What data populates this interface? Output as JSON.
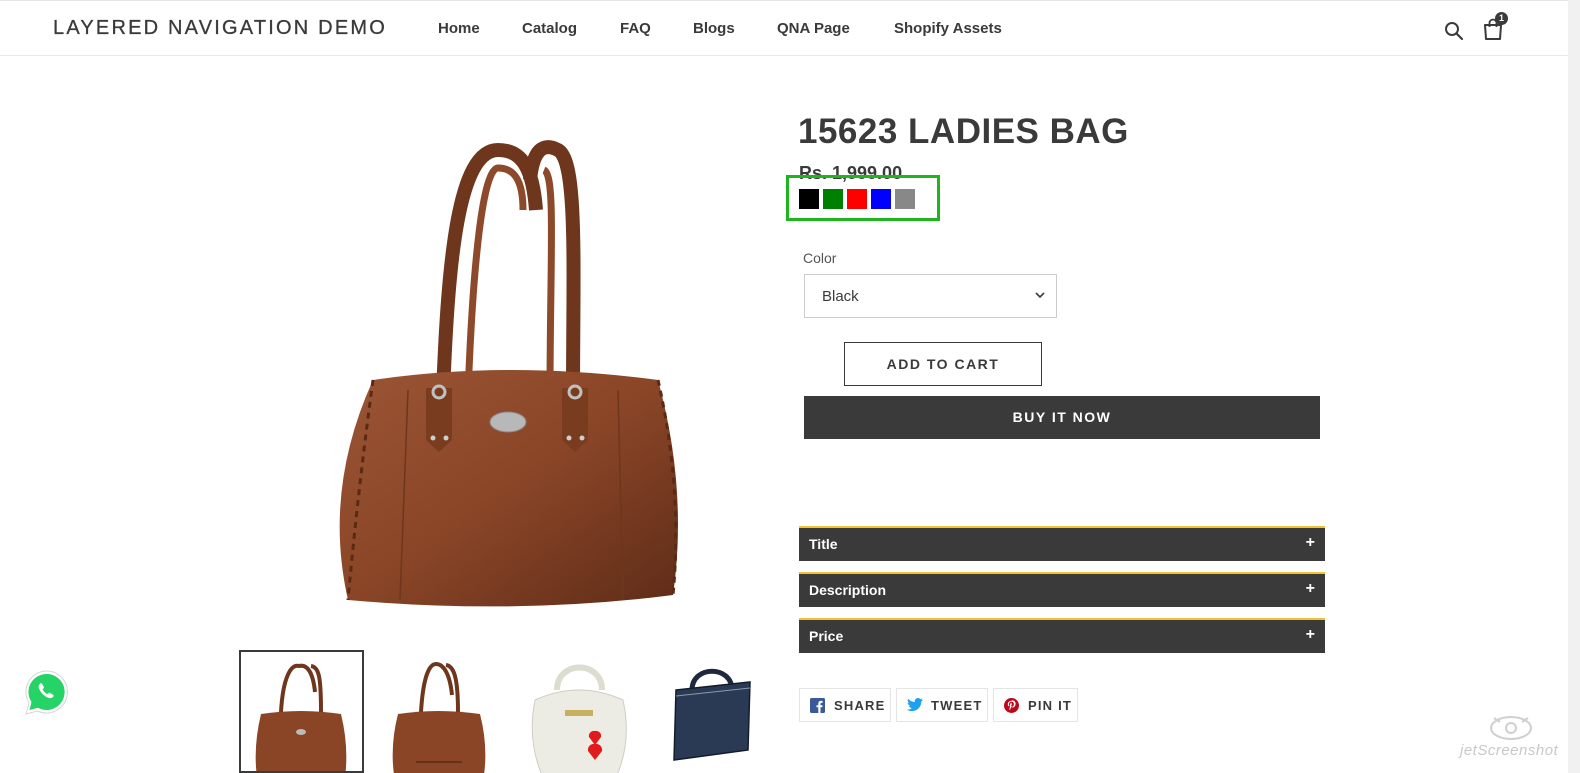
{
  "store": {
    "name": "LAYERED NAVIGATION DEMO"
  },
  "nav": {
    "items": [
      "Home",
      "Catalog",
      "FAQ",
      "Blogs",
      "QNA Page",
      "Shopify Assets"
    ]
  },
  "header_icons": {
    "search": "search-icon",
    "cart": "shopping-bag-icon",
    "cart_count": "1"
  },
  "product": {
    "title": "15623 LADIES BAG",
    "price": "Rs. 1,999.00",
    "swatches": [
      {
        "name": "black",
        "color": "#000000"
      },
      {
        "name": "green",
        "color": "#008000"
      },
      {
        "name": "red",
        "color": "#ff0000"
      },
      {
        "name": "blue",
        "color": "#0000ff"
      },
      {
        "name": "gray",
        "color": "#888888"
      }
    ],
    "color_label": "Color",
    "color_selected": "Black",
    "add_to_cart": "ADD TO CART",
    "buy_now": "BUY IT NOW"
  },
  "accordion": [
    {
      "label": "Title",
      "icon": "+"
    },
    {
      "label": "Description",
      "icon": "+"
    },
    {
      "label": "Price",
      "icon": "+"
    }
  ],
  "share": {
    "facebook": "SHARE",
    "twitter": "TWEET",
    "pinterest": "PIN IT"
  },
  "thumbnails": [
    "brown-bag-front",
    "brown-bag-back",
    "white-bag",
    "navy-laptop-bag"
  ],
  "colors": {
    "accent_dark": "#3a3a3a",
    "highlight": "#1fb51f",
    "accordion_border": "#f1c232",
    "facebook": "#3b5998",
    "twitter": "#1da1f2",
    "pinterest": "#bd081c",
    "whatsapp": "#25d366"
  },
  "watermark": {
    "text": "jetScreenshot"
  }
}
